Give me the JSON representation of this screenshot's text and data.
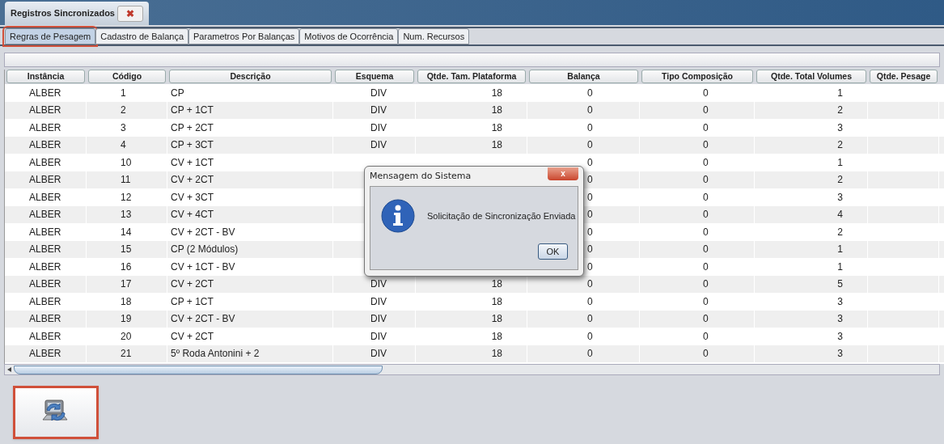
{
  "main_tab": {
    "label": "Registros Sincronizados",
    "close_label": "✖"
  },
  "tabs": [
    {
      "label": "Regras de Pesagem",
      "selected": true
    },
    {
      "label": "Cadastro de Balança",
      "selected": false
    },
    {
      "label": "Parametros Por Balanças",
      "selected": false
    },
    {
      "label": "Motivos de Ocorrência",
      "selected": false
    },
    {
      "label": "Num. Recursos",
      "selected": false
    }
  ],
  "table": {
    "columns": [
      "Instância",
      "Código",
      "Descrição",
      "Esquema",
      "Qtde. Tam. Plataforma",
      "Balança",
      "Tipo Composição",
      "Qtde. Total Volumes",
      "Qtde. Pesage"
    ],
    "rows": [
      [
        "ALBER",
        "1",
        "CP",
        "DIV",
        "18",
        "0",
        "0",
        "1",
        null
      ],
      [
        "ALBER",
        "2",
        "CP + 1CT",
        "DIV",
        "18",
        "0",
        "0",
        "2",
        null
      ],
      [
        "ALBER",
        "3",
        "CP + 2CT",
        "DIV",
        "18",
        "0",
        "0",
        "3",
        null
      ],
      [
        "ALBER",
        "4",
        "CP + 3CT",
        "DIV",
        "18",
        "0",
        "0",
        "2",
        null
      ],
      [
        "ALBER",
        "10",
        "CV + 1CT",
        null,
        null,
        "0",
        "0",
        "1",
        null
      ],
      [
        "ALBER",
        "11",
        "CV + 2CT",
        null,
        null,
        "0",
        "0",
        "2",
        null
      ],
      [
        "ALBER",
        "12",
        "CV + 3CT",
        null,
        null,
        "0",
        "0",
        "3",
        null
      ],
      [
        "ALBER",
        "13",
        "CV + 4CT",
        null,
        null,
        "0",
        "0",
        "4",
        null
      ],
      [
        "ALBER",
        "14",
        "CV + 2CT - BV",
        null,
        null,
        "0",
        "0",
        "2",
        null
      ],
      [
        "ALBER",
        "15",
        "CP (2 Módulos)",
        null,
        null,
        "0",
        "0",
        "1",
        null
      ],
      [
        "ALBER",
        "16",
        "CV + 1CT - BV",
        null,
        null,
        "0",
        "0",
        "1",
        null
      ],
      [
        "ALBER",
        "17",
        "CV + 2CT",
        "DIV",
        "18",
        "0",
        "0",
        "5",
        null
      ],
      [
        "ALBER",
        "18",
        "CP + 1CT",
        "DIV",
        "18",
        "0",
        "0",
        "3",
        null
      ],
      [
        "ALBER",
        "19",
        "CV + 2CT - BV",
        "DIV",
        "18",
        "0",
        "0",
        "3",
        null
      ],
      [
        "ALBER",
        "20",
        "CV + 2CT",
        "DIV",
        "18",
        "0",
        "0",
        "3",
        null
      ],
      [
        "ALBER",
        "21",
        "5º Roda Antonini + 2",
        "DIV",
        "18",
        "0",
        "0",
        "3",
        null
      ]
    ]
  },
  "dialog": {
    "title": "Mensagem do Sistema",
    "close_label": "x",
    "message": "Solicitação de Sincronização Enviada",
    "button": "OK"
  }
}
